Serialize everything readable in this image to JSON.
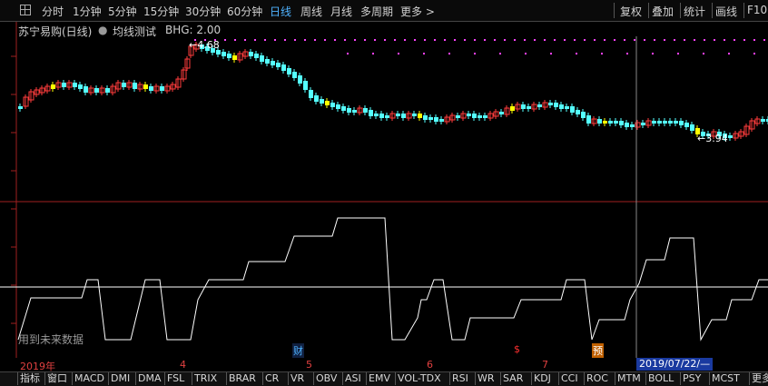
{
  "toolbar": {
    "periods": [
      "分时",
      "1分钟",
      "5分钟",
      "15分钟",
      "30分钟",
      "60分钟",
      "日线",
      "周线",
      "月线",
      "多周期",
      "更多 >"
    ],
    "active": "日线",
    "right_buttons": [
      "复权",
      "叠加",
      "统计",
      "画线",
      "F10"
    ]
  },
  "info": {
    "stock": "苏宁易购(日线)",
    "indicator_name": "均线测试",
    "indicator_value": "BHG: 2.00"
  },
  "annotations": {
    "high_label": "←4.68",
    "low_label": "←3.94",
    "future_data_note": "用到未来数据",
    "cursor_date": "2019/07/22/—"
  },
  "date_axis": {
    "year_label": "2019年",
    "months": [
      "4",
      "5",
      "6",
      "7"
    ]
  },
  "event_markers": [
    {
      "label": "财",
      "color": "#4fb3ff"
    },
    {
      "label": "$",
      "color": "#ff3030"
    },
    {
      "label": "预",
      "color": "#ffa000"
    }
  ],
  "tabs": [
    "指标",
    "窗口",
    "MACD",
    "DMI",
    "DMA",
    "FSL",
    "TRIX",
    "BRAR",
    "CR",
    "VR",
    "OBV",
    "ASI",
    "EMV",
    "VOL-TDX",
    "RSI",
    "WR",
    "SAR",
    "KDJ",
    "CCI",
    "ROC",
    "MTM",
    "BOLL",
    "PSY",
    "MCST",
    "更多"
  ],
  "colors": {
    "up": "#ff3c3c",
    "down": "#54ffff",
    "doji": "#ffff00",
    "line": "#ffffff",
    "dots": "#ff40ff",
    "accent": "#4fb3ff"
  }
}
